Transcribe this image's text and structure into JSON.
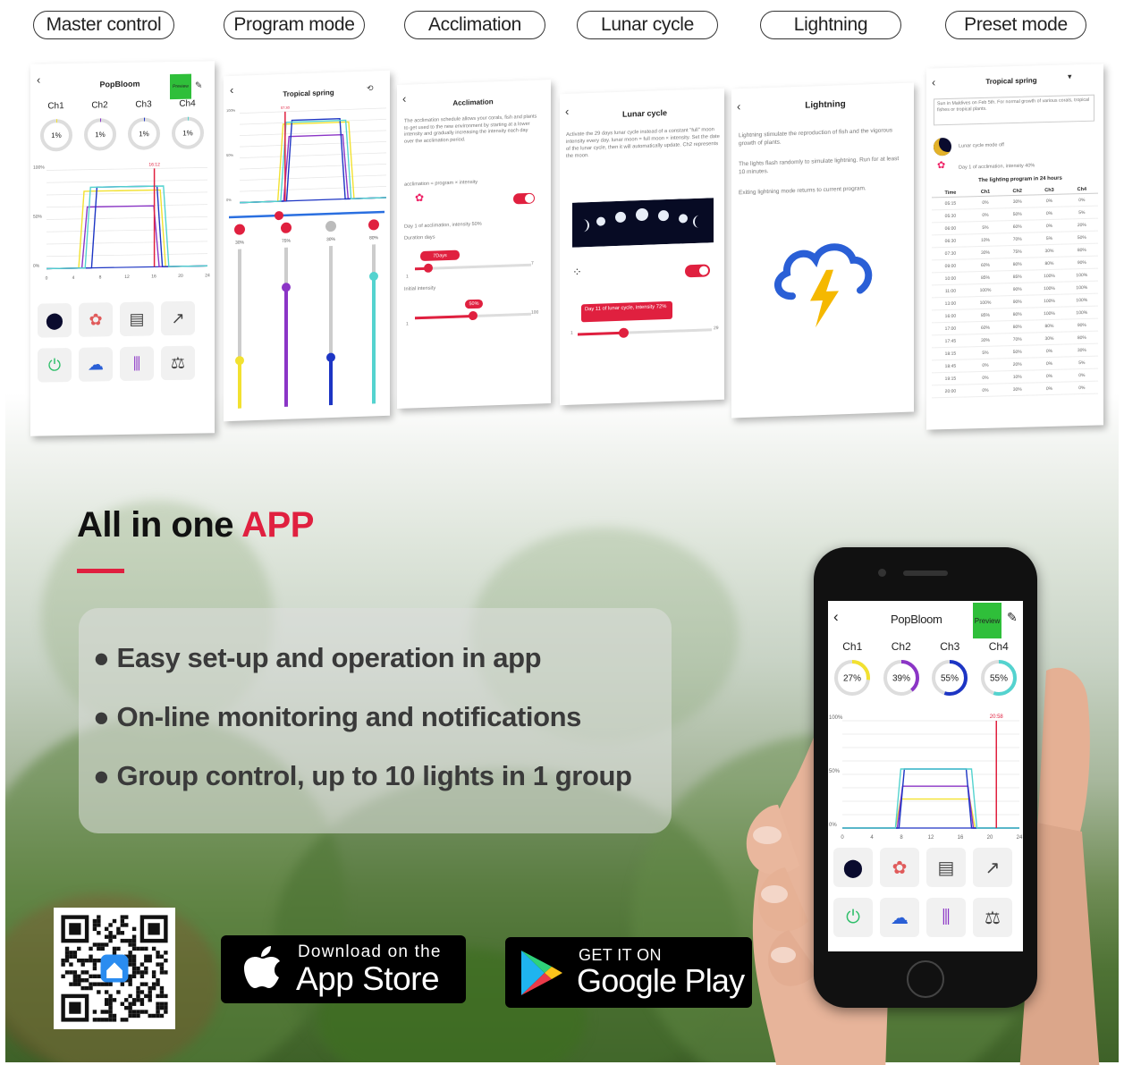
{
  "tabs": [
    "Master control",
    "Program mode",
    "Acclimation",
    "Lunar cycle",
    "Lightning",
    "Preset mode"
  ],
  "cards": {
    "master": {
      "title": "PopBloom",
      "preview": "Preview",
      "channels": [
        "Ch1",
        "Ch2",
        "Ch3",
        "Ch4"
      ],
      "values": [
        "1%",
        "1%",
        "1%",
        "1%"
      ],
      "y_labels": [
        "100%",
        "50%",
        "0%"
      ],
      "x_labels": [
        "0",
        "4",
        "8",
        "12",
        "16",
        "20",
        "24"
      ],
      "marker": "16:12"
    },
    "program": {
      "title": "Tropical spring",
      "marker": "07:30",
      "slider_values": [
        "30%",
        "75%",
        "30%",
        "80%"
      ],
      "y_labels": [
        "100%",
        "50%",
        "0%"
      ]
    },
    "acclimation": {
      "title": "Acclimation",
      "desc": "The acclimation schedule allows your corals, fish and plants to get used to the new environment by starting at a lower intensity and gradually increasing the intensity each day over the acclimation period.",
      "formula": "acclimation = program × intensity",
      "status": "Day 1 of acclimation, intensity 50%",
      "duration_label": "Duration days",
      "duration_value": "7Days",
      "intensity_label": "Initial intensity",
      "intensity_value": "50%",
      "range1_min": "1",
      "range1_max": "7",
      "range2_min": "1",
      "range2_max": "100"
    },
    "lunar": {
      "title": "Lunar cycle",
      "desc": "Activate the 29 days lunar cycle instead of a constant \"full\" moon intensity every day. lunar moon = full moon × intensity. Set the date of the lunar cycle, then it will automatically update. Ch2 represents the moon.",
      "status": "Day 11 of lunar cycle, intensity 72%",
      "range_min": "1",
      "range_max": "29"
    },
    "lightning": {
      "title": "Lightning",
      "p1": "Lightning stimulate the reproduction of fish and the vigorous growth of plants.",
      "p2": "The lights flash randomly to simulate lightning. Run for at least 10 minutes.",
      "p3": "Exiting lightning mode returns to current program."
    },
    "preset": {
      "title": "Tropical spring",
      "note": "Sun in Maldives on Feb 5th. For normal growth of various corals, tropical fishes or tropical plants.",
      "status1": "Lunar cycle mode off",
      "status2": "Day 1 of acclimation, intensity 40%",
      "table_title": "The lighting program in 24 hours",
      "headers": [
        "Time",
        "Ch1",
        "Ch2",
        "Ch3",
        "Ch4"
      ],
      "rows": [
        [
          "05:15",
          "0%",
          "30%",
          "0%",
          "0%"
        ],
        [
          "05:30",
          "0%",
          "50%",
          "0%",
          "5%"
        ],
        [
          "06:00",
          "5%",
          "60%",
          "0%",
          "20%"
        ],
        [
          "06:30",
          "10%",
          "70%",
          "5%",
          "50%"
        ],
        [
          "07:30",
          "30%",
          "75%",
          "30%",
          "80%"
        ],
        [
          "09:00",
          "60%",
          "80%",
          "80%",
          "90%"
        ],
        [
          "10:00",
          "85%",
          "85%",
          "100%",
          "100%"
        ],
        [
          "11:00",
          "100%",
          "90%",
          "100%",
          "100%"
        ],
        [
          "13:00",
          "100%",
          "90%",
          "100%",
          "100%"
        ],
        [
          "16:00",
          "85%",
          "80%",
          "100%",
          "100%"
        ],
        [
          "17:00",
          "60%",
          "80%",
          "80%",
          "90%"
        ],
        [
          "17:45",
          "30%",
          "70%",
          "30%",
          "80%"
        ],
        [
          "18:15",
          "5%",
          "50%",
          "0%",
          "30%"
        ],
        [
          "18:45",
          "0%",
          "20%",
          "0%",
          "5%"
        ],
        [
          "19:15",
          "0%",
          "10%",
          "0%",
          "0%"
        ],
        [
          "20:00",
          "0%",
          "30%",
          "0%",
          "0%"
        ]
      ]
    }
  },
  "hero": {
    "title_main": "All in one ",
    "title_accent": "APP",
    "features": [
      "Easy set-up and operation in app",
      "On-line monitoring and notifications",
      "Group control, up to 10 lights in 1 group"
    ]
  },
  "badges": {
    "apple_small": "Download on the",
    "apple_big": "App Store",
    "google_small": "GET IT ON",
    "google_big": "Google Play"
  },
  "phone": {
    "title": "PopBloom",
    "preview": "Preview",
    "channels": [
      "Ch1",
      "Ch2",
      "Ch3",
      "Ch4"
    ],
    "values": [
      "27%",
      "39%",
      "55%",
      "55%"
    ],
    "levels": [
      0.27,
      0.39,
      0.55,
      0.55
    ],
    "y_labels": [
      "100%",
      "50%",
      "0%"
    ],
    "x_labels": [
      "0",
      "4",
      "8",
      "12",
      "16",
      "20",
      "24"
    ],
    "marker": "20:58"
  },
  "colors": {
    "accent": "#e0203f",
    "ch1": "#f2e130",
    "ch2": "#8b35c6",
    "ch3": "#1d35c4",
    "ch4": "#54d3cf",
    "preview": "#2fbf3a"
  }
}
